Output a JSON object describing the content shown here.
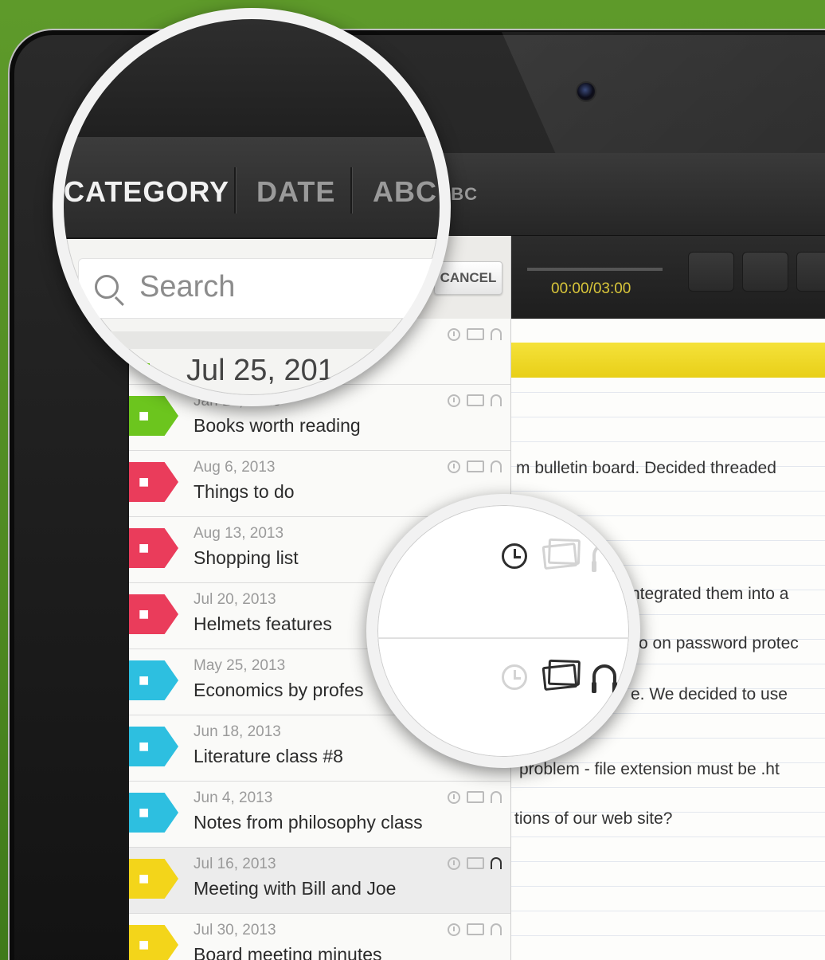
{
  "tabs": {
    "category": "CATEGORY",
    "date": "DATE",
    "abc": "ABC",
    "abc_partial": "BC"
  },
  "search": {
    "placeholder": "Search",
    "cancel_label": "CANCEL"
  },
  "player": {
    "time": "00:00/03:00"
  },
  "magnified_date": "Jul 25, 201",
  "notes": [
    {
      "date": "Jan 10, 2013",
      "title": "Books worth reading",
      "tag_color": "#6cc51e",
      "tag_icon": "note-icon",
      "audio": false
    },
    {
      "date": "Aug 6, 2013",
      "title": "Things to do",
      "tag_color": "#ea3c5b",
      "tag_icon": "pin-icon",
      "audio": false
    },
    {
      "date": "Aug 13, 2013",
      "title": "Shopping list",
      "tag_color": "#ea3c5b",
      "tag_icon": "pin-icon",
      "audio": false
    },
    {
      "date": "Jul 20, 2013",
      "title": "Helmets features",
      "tag_color": "#ea3c5b",
      "tag_icon": "pin-icon",
      "audio": false
    },
    {
      "date": "May 25, 2013",
      "title": "Economics by profes",
      "tag_color": "#2dbfe0",
      "tag_icon": "presentation-icon",
      "audio": false
    },
    {
      "date": "Jun 18, 2013",
      "title": "Literature class #8",
      "tag_color": "#2dbfe0",
      "tag_icon": "presentation-icon",
      "audio": false
    },
    {
      "date": "Jun 4, 2013",
      "title": "Notes from philosophy class",
      "tag_color": "#2dbfe0",
      "tag_icon": "presentation-icon",
      "audio": false
    },
    {
      "date": "Jul 16, 2013",
      "title": "Meeting with Bill and Joe",
      "tag_color": "#f3d51a",
      "tag_icon": "people-icon",
      "audio": true
    },
    {
      "date": "Jul 30, 2013",
      "title": "Board meeting minutes",
      "tag_color": "#f3d51a",
      "tag_icon": "people-icon",
      "audio": false
    }
  ],
  "note_text": {
    "line1": "m bulletin board.  Decided threaded",
    "line2": "ntegrated them into a",
    "line3": "o on password protec",
    "line4": "e. We decided to use",
    "line5": "problem - file extension must be .ht",
    "line6": "tions of our web site?"
  },
  "colors": {
    "background_green": "#5e9a2a",
    "player_time": "#d9c63a",
    "highlight_yellow": "#f5e23a"
  }
}
